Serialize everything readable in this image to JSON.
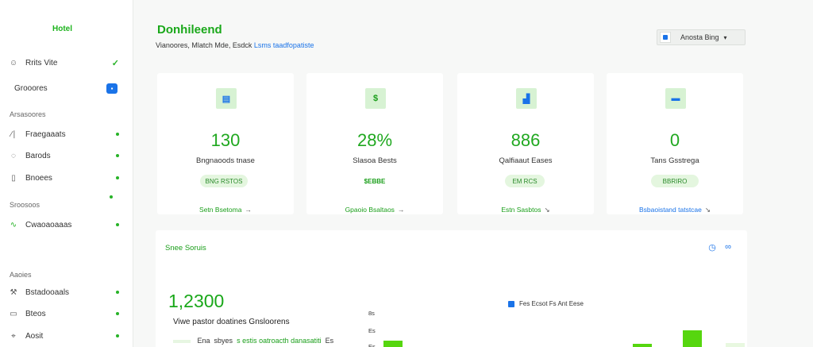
{
  "sidebar": {
    "brand": "Hotel",
    "items": [
      {
        "label": "Rrits Vite",
        "icon": "user-circle-icon",
        "glyph": "☺",
        "marker": "check"
      },
      {
        "label": "Grooores",
        "icon": "",
        "glyph": "",
        "marker": "badge"
      },
      {
        "label": "Fraegaaats",
        "icon": "bar-chart-icon",
        "glyph": "∕∣",
        "marker": "dot"
      },
      {
        "label": "Barods",
        "icon": "chat-icon",
        "glyph": "◌",
        "marker": "dot"
      },
      {
        "label": "Bnoees",
        "icon": "file-icon",
        "glyph": "▯",
        "marker": "dot"
      },
      {
        "label": "Cwaoaoaaas",
        "icon": "pulse-icon",
        "glyph": "∿",
        "marker": "dot"
      },
      {
        "label": "Bstadooaals",
        "icon": "tool-icon",
        "glyph": "⚒",
        "marker": "dot"
      },
      {
        "label": "Bteos",
        "icon": "message-icon",
        "glyph": "▭",
        "marker": "dot"
      },
      {
        "label": "Aosit",
        "icon": "pin-icon",
        "glyph": "⌖",
        "marker": "dot"
      }
    ],
    "sections": [
      "Arsasoores",
      "Sroosoos",
      "Aaoies"
    ]
  },
  "header": {
    "title": "Donhileend",
    "subtitle_text": "Vianoores, Mlatch Mde, Esdck",
    "subtitle_link": "Lsms taadfopatiste",
    "user_label": "Anosta Bing",
    "caret": "▾"
  },
  "cards": [
    {
      "icon": "calendar-icon",
      "glyph": "▤",
      "icon_color": "#1a73e8",
      "value": "130",
      "label": "Bngnaoods tnase",
      "pill": "BNG RSTOS",
      "pill_bg": "#e4f6df",
      "pill_color": "#2a8a2a",
      "link": "Setn Bsetoma",
      "arrow": "→"
    },
    {
      "icon": "dollar-icon",
      "glyph": "$",
      "icon_color": "#1a9e1a",
      "value": "28%",
      "label": "Slasoa Bests",
      "pill": "$EBBE",
      "pill_bg": "#ffffff",
      "pill_color": "#1a9e1a",
      "link": "Gpaoio Bsaltaos",
      "arrow": "→"
    },
    {
      "icon": "bar-chart-icon",
      "glyph": "▟",
      "icon_color": "#1a73e8",
      "value": "886",
      "label": "Qalfiaaut Eases",
      "pill": "EM RCS",
      "pill_bg": "#e4f6df",
      "pill_color": "#2a8a2a",
      "link": "Estn Sasbtos",
      "arrow": "↘"
    },
    {
      "icon": "wallet-icon",
      "glyph": "▬",
      "icon_color": "#1a73e8",
      "value": "0",
      "label": "Tans Gsstrega",
      "pill": "BBRIRO",
      "pill_bg": "#e4f6df",
      "pill_color": "#2a8a2a",
      "link": "Bsbaoistand tatstcae",
      "arrow": "↘"
    }
  ],
  "chart_panel": {
    "title": "Snee Soruis",
    "big_number": "1,2300",
    "big_sub": "Viwe pastor doatines Gnsloorens",
    "footer_prefix": "Ena",
    "footer_mid": "sbyes",
    "footer_green": "s estis oatroacth danasatiti",
    "footer_suffix": "Es",
    "legend": "Fes Ecsot Fs Ant Eese",
    "icons": [
      "clock-icon",
      "link-icon"
    ]
  },
  "chart_data": {
    "type": "bar",
    "yticks": [
      "8s",
      "Es",
      "Es"
    ],
    "series": [
      {
        "name": "Fes Ecsot Fs Ant Eese",
        "values": [
          12,
          8,
          27
        ]
      }
    ],
    "categories": [
      "",
      "",
      ""
    ]
  }
}
